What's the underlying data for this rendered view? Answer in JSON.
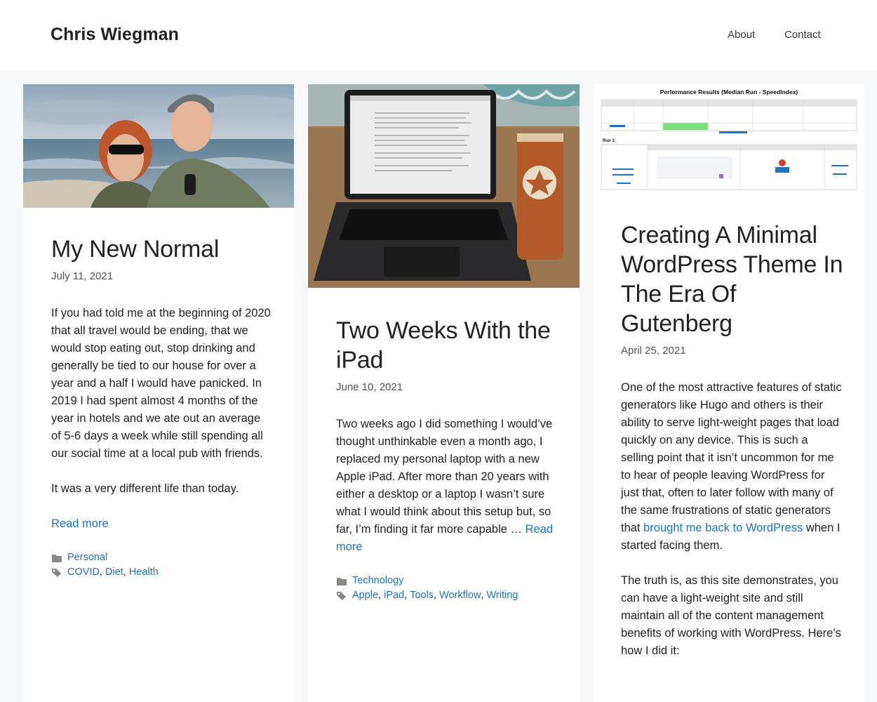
{
  "site": {
    "title": "Chris Wiegman"
  },
  "nav": {
    "about": "About",
    "contact": "Contact"
  },
  "posts": [
    {
      "title": "My New Normal",
      "date": "July 11, 2021",
      "paragraphs": [
        "If you had told me at the beginning of 2020 that all travel would be ending, that we would stop eating out, stop drinking and generally be tied to our house for over a year and a half I would have panicked. In 2019 I had spent almost 4 months of the year in hotels and we ate out an average of 5-6 days a week while still spending all our social time at a local pub with friends.",
        "It was a very different life than today."
      ],
      "read_more": "Read more",
      "categories": [
        "Personal"
      ],
      "tags": [
        "COVID",
        "Diet",
        "Health"
      ]
    },
    {
      "title": "Two Weeks With the iPad",
      "date": "June 10, 2021",
      "excerpt": "Two weeks ago I did something I would’ve thought unthinkable even a month ago, I replaced my personal laptop with a new Apple iPad. After more than 20 years with either a desktop or a laptop I wasn’t sure what I would think about this setup but, so far, I’m finding it far more capable …",
      "read_more": "Read more",
      "categories": [
        "Technology"
      ],
      "tags": [
        "Apple",
        "iPad",
        "Tools",
        "Workflow",
        "Writing"
      ]
    },
    {
      "title": "Creating A Minimal WordPress Theme In The Era Of Gutenberg",
      "date": "April 25, 2021",
      "p1_before": "One of the most attractive features of static generators like Hugo and others is their ability to serve light-weight pages that load quickly on any device. This is such a selling point that it isn’t uncommon for me to hear of people leaving WordPress for just that, often to later follow with many of the same frustrations of static generators that ",
      "p1_link": "brought me back to WordPress",
      "p1_after": " when I started facing them.",
      "p2": "The truth is, as this site demonstrates, you can have a light-weight site and still maintain all of the content management benefits of working with WordPress. Here’s how I did it:",
      "thumb_heading": "Performance Results (Median Run - SpeedIndex)",
      "thumb_run": "Run 1:"
    }
  ],
  "icons": {
    "category": "folder-icon",
    "tag": "tags-icon"
  },
  "colors": {
    "link": "#1e73be",
    "background": "#f7f8f9"
  }
}
